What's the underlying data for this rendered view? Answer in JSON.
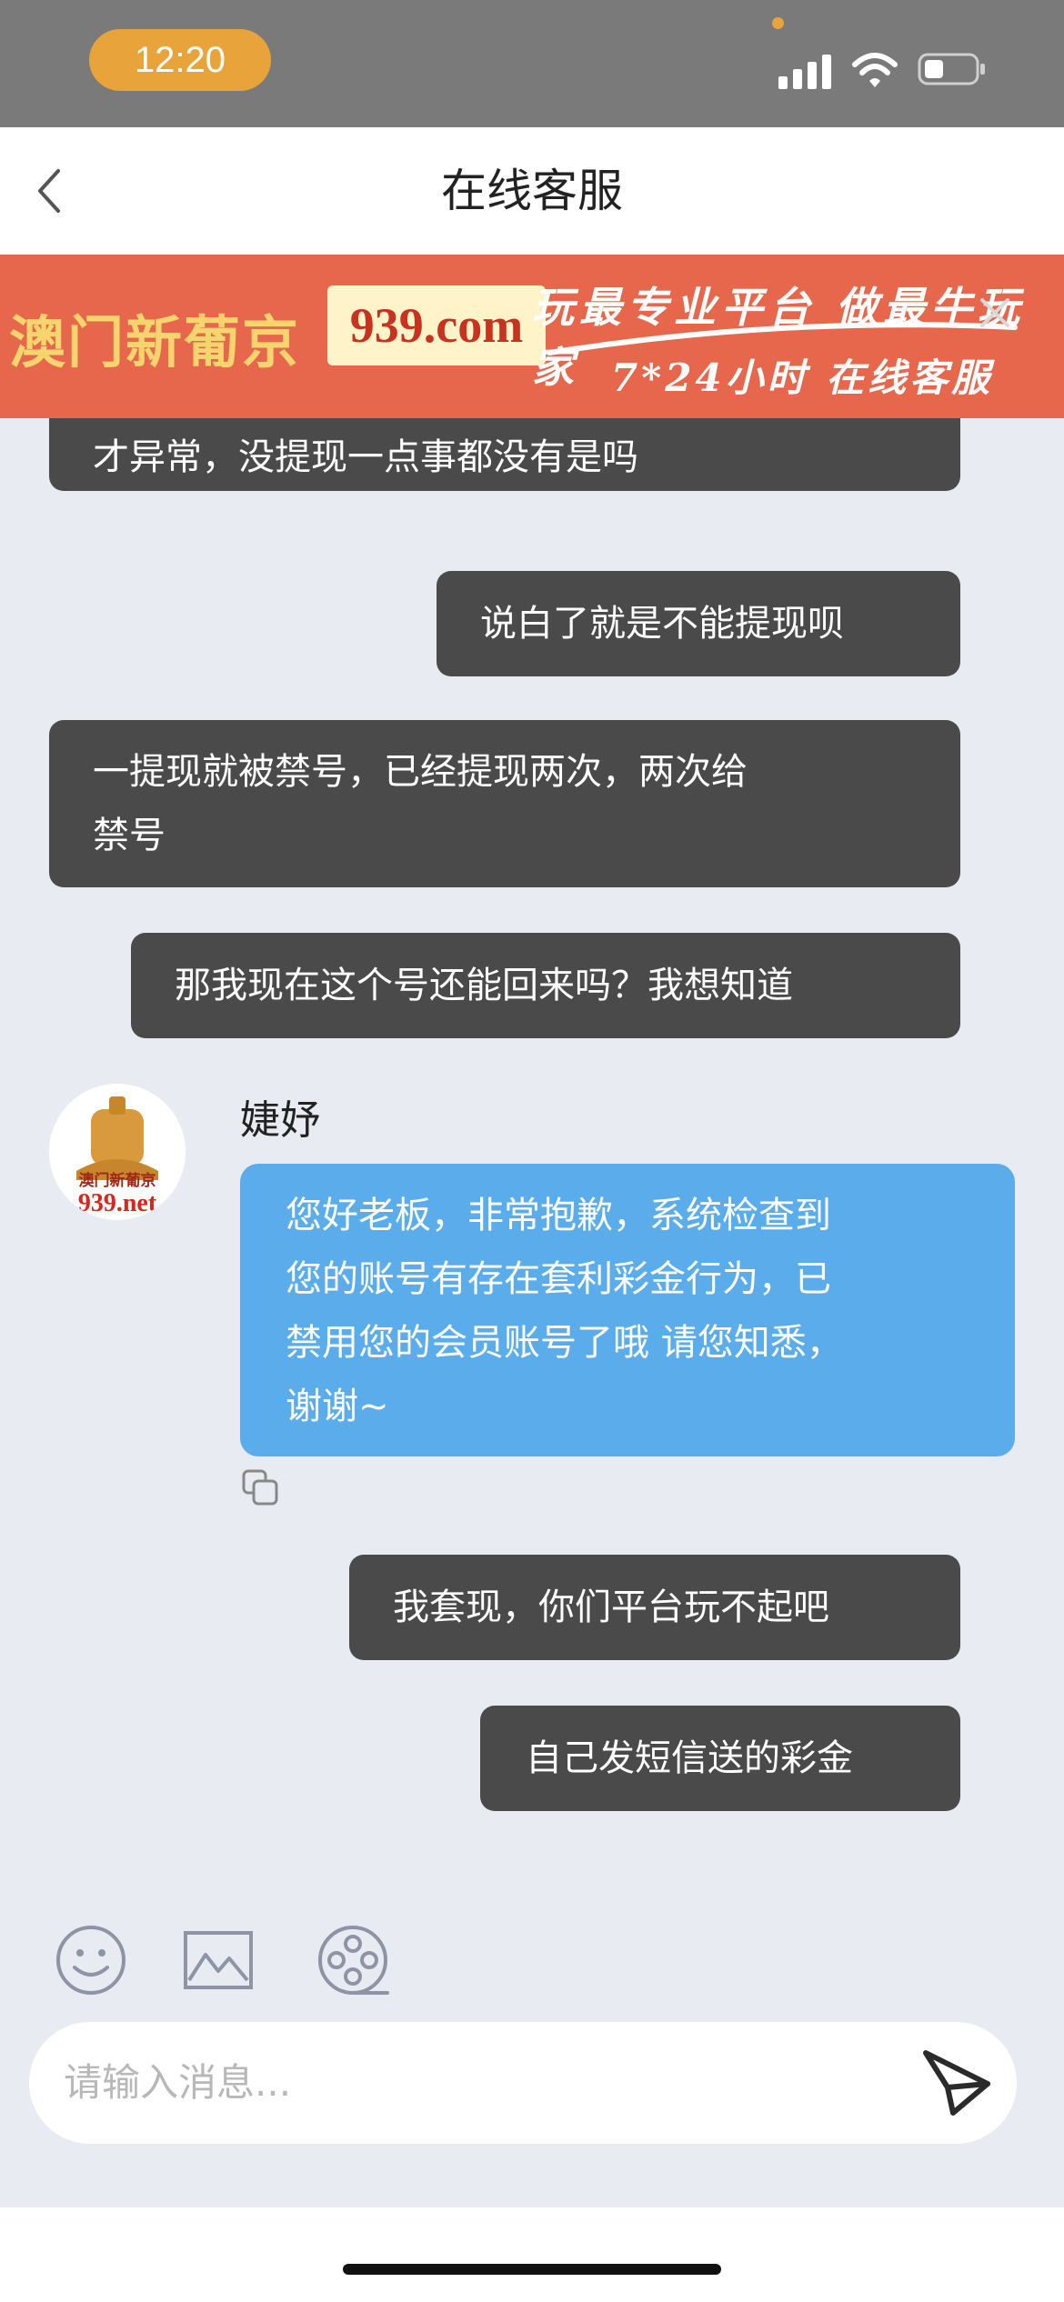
{
  "status_bar": {
    "time": "12:20"
  },
  "header": {
    "title": "在线客服"
  },
  "banner": {
    "brand": "澳门新葡京",
    "domain": "939.com",
    "slogan_line1": "玩最专业平台 做最牛玩家",
    "slogan_line2": "7*24小时 在线客服"
  },
  "messages": [
    {
      "from": "user",
      "text": "才异常，没提现一点事都没有是吗"
    },
    {
      "from": "user",
      "text": "说白了就是不能提现呗"
    },
    {
      "from": "user",
      "text_lines": [
        "一提现就被禁号，已经提现两次，两次给",
        "禁号"
      ]
    },
    {
      "from": "user",
      "text": "那我现在这个号还能回来吗？我想知道"
    },
    {
      "from": "agent",
      "name": "婕妤",
      "avatar_text": [
        "澳门新葡京",
        "939.net"
      ],
      "text_lines": [
        "您好老板，非常抱歉，系统检查到",
        "您的账号有存在套利彩金行为，已",
        "禁用您的会员账号了哦 请您知悉，",
        "谢谢~"
      ]
    },
    {
      "from": "user",
      "text": "我套现，你们平台玩不起吧"
    },
    {
      "from": "user",
      "text": "自己发短信送的彩金"
    }
  ],
  "composer": {
    "placeholder": "请输入消息..."
  },
  "icons": [
    "back-icon",
    "close-icon",
    "emoji-icon",
    "image-icon",
    "video-icon",
    "copy-icon",
    "send-icon"
  ],
  "colors": {
    "status_bar": "#7a7a7a",
    "time_pill": "#e8a43a",
    "banner": "#e6674c",
    "dark_bubble": "#4a4a4a",
    "agent_bubble": "#5aadea",
    "chat_bg": "#e9ebf2"
  }
}
